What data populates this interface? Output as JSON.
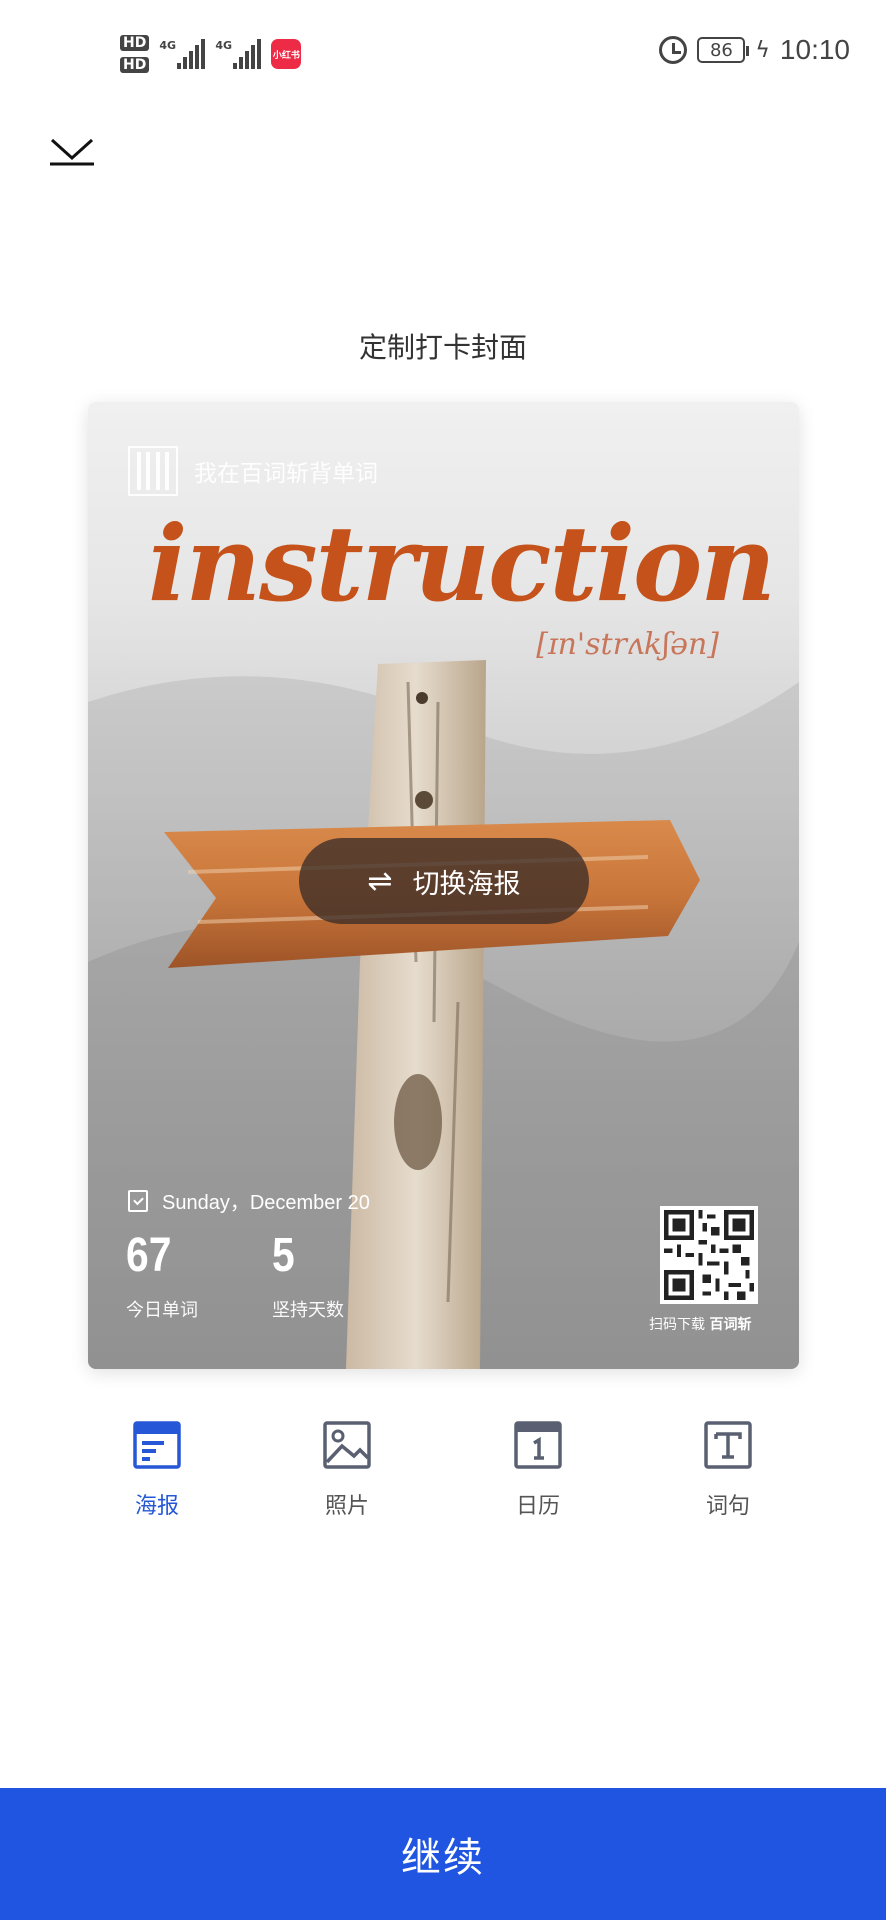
{
  "status_bar": {
    "hd1": "HD",
    "hd2": "HD",
    "signal1_label": "4G",
    "signal2_label": "4G",
    "app_badge": "小红书",
    "battery": "86",
    "time": "10:10"
  },
  "header": {
    "title": "定制打卡封面"
  },
  "poster": {
    "brand_text": "我在百词斩背单词",
    "word": "instruction",
    "phonetic": "[ɪn'strʌkʃən]",
    "switch_label": "切换海报",
    "date": "Sunday，December 20",
    "stats": {
      "today_words_value": "67",
      "today_words_label": "今日单词",
      "streak_days_value": "5",
      "streak_days_label": "坚持天数"
    },
    "qr_caption_prefix": "扫码下载",
    "qr_caption_brand": "百词斩"
  },
  "tabs": [
    {
      "label": "海报",
      "icon": "poster-icon",
      "active": true
    },
    {
      "label": "照片",
      "icon": "photo-icon",
      "active": false
    },
    {
      "label": "日历",
      "icon": "calendar-icon",
      "active": false
    },
    {
      "label": "词句",
      "icon": "text-icon",
      "active": false
    }
  ],
  "continue_label": "继续",
  "colors": {
    "accent": "#1f55e0",
    "tab_active": "#2557d6",
    "tab_inactive": "#5a6072",
    "word": "#c4521a"
  }
}
